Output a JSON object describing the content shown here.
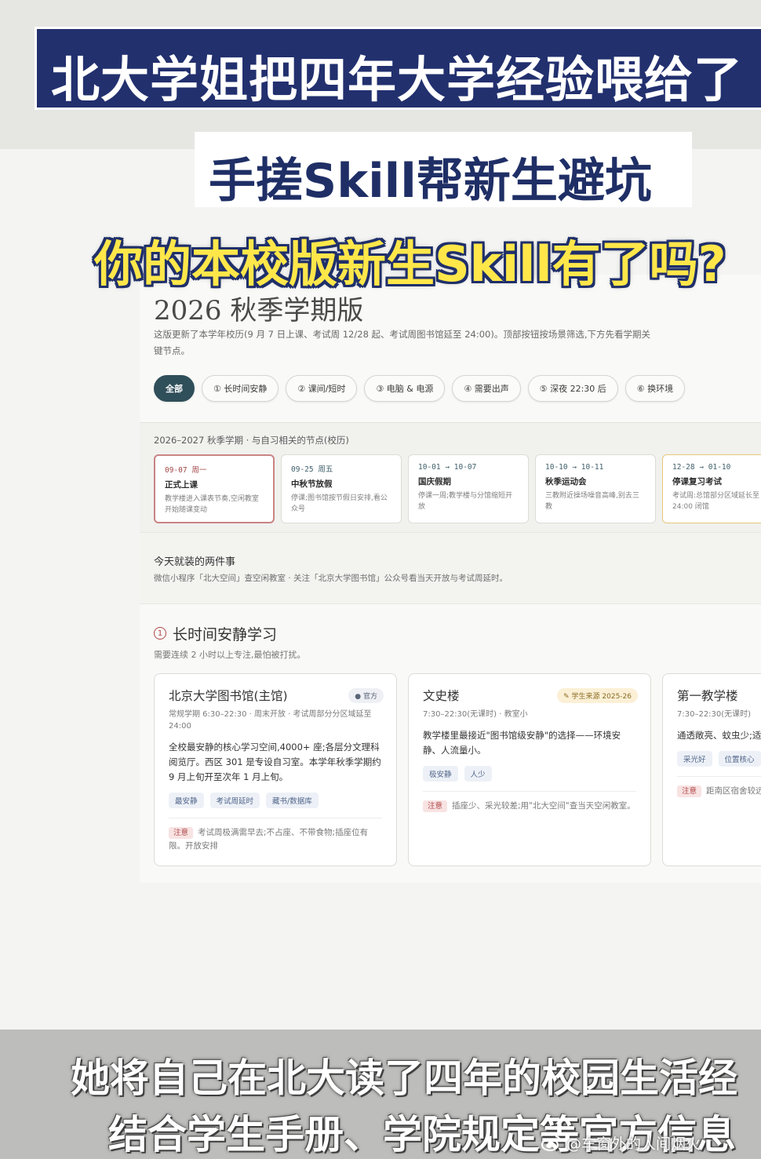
{
  "overlay": {
    "headline": "北大学姐把四年大学经验喂给了",
    "subheadline": "手搓Skill帮新生避坑",
    "question": "你的本校版新生Skill有了吗?",
    "subtitle_line1": "她将自己在北大读了四年的校园生活经",
    "subtitle_line2": "结合学生手册、学院规定等官方信息",
    "watermark": "@车窗外的人间烟火"
  },
  "page": {
    "title": "2026 秋季学期版",
    "description": "这版更新了本学年校历(9 月 7 日上课、考试周 12/28 起、考试周图书馆延至 24:00)。顶部按钮按场景筛选,下方先看学期关键节点。",
    "filters": [
      {
        "label": "全部",
        "active": true
      },
      {
        "label": "① 长时间安静"
      },
      {
        "label": "② 课间/短时"
      },
      {
        "label": "③ 电脑 & 电源"
      },
      {
        "label": "④ 需要出声"
      },
      {
        "label": "⑤ 深夜 22:30 后"
      },
      {
        "label": "⑥ 换环境"
      }
    ],
    "term": {
      "heading": "2026–2027 秋季学期 · 与自习相关的节点(校历)",
      "nodes": [
        {
          "date": "09-07 周一",
          "name": "正式上课",
          "desc": "教学楼进入课表节奏,空闲教室开始随课变动"
        },
        {
          "date": "09-25 周五",
          "name": "中秋节放假",
          "desc": "停课;图书馆按节假日安排,看公众号"
        },
        {
          "date": "10-01 → 10-07",
          "name": "国庆假期",
          "desc": "停课一周;教学楼与分馆缩短开放"
        },
        {
          "date": "10-10 → 10-11",
          "name": "秋季运动会",
          "desc": "三教附近操场噪音高峰,别去三教"
        },
        {
          "date": "12-28 → 01-10",
          "name": "停课复习考试",
          "desc": "考试周:总馆部分区域延长至 24:00 闭馆"
        }
      ]
    },
    "today": {
      "title": "今天就装的两件事",
      "desc": "微信小程序「北大空间」查空闲教室 · 关注「北京大学图书馆」公众号看当天开放与考试周延时。"
    },
    "section": {
      "number": "1",
      "title": "长时间安静学习",
      "subtitle": "需要连续 2 小时以上专注,最怕被打扰。"
    },
    "places": [
      {
        "name": "北京大学图书馆(主馆)",
        "badge": "● 官方",
        "hours": "常规学期 6:30–22:30 · 周末开放 · 考试周部分分区域延至 24:00",
        "body": "全校最安静的核心学习空间,4000+ 座;各层分文理科阅览厅。西区 301 是专设自习室。本学年秋季学期约 9 月上旬开至次年 1 月上旬。",
        "tags": [
          "最安静",
          "考试周延时",
          "藏书/数据库"
        ],
        "note_label": "注意",
        "note": "考试周极满需早去;不占座、不带食物;插座位有限。开放安排"
      },
      {
        "name": "文史楼",
        "badge": "✎ 学生来源 2025-26",
        "hours": "7:30–22:30(无课时) · 教室小",
        "body": "教学楼里最接近\"图书馆级安静\"的选择——环境安静、人流量小。",
        "tags": [
          "极安静",
          "人少"
        ],
        "note_label": "注意",
        "note": "插座少、采光较差;用\"北大空间\"查当天空闲教室。"
      },
      {
        "name": "第一教学楼",
        "badge": "",
        "hours": "7:30–22:30(无课时)",
        "body": "通透敞亮、蚊虫少;适",
        "tags": [
          "采光好",
          "位置核心"
        ],
        "note_label": "注意",
        "note": "距南区宿舍较远,步行需时较久。"
      }
    ]
  }
}
